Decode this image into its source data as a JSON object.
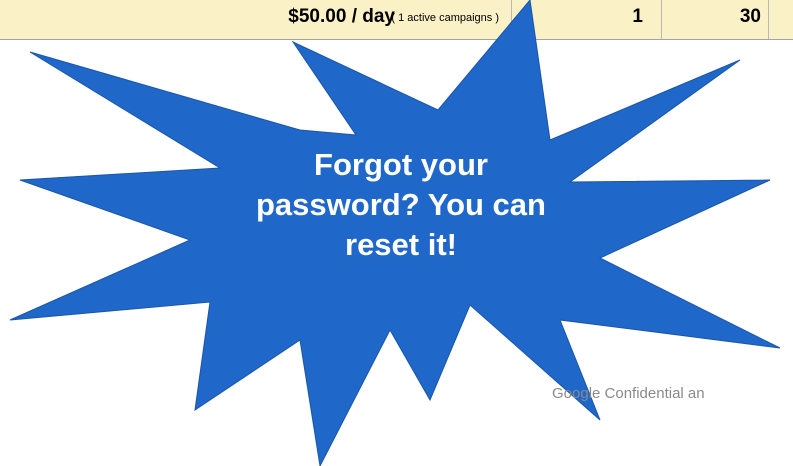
{
  "summary_row": {
    "budget_amount": "$50.00 / day",
    "budget_note": "( 1 active campaigns )",
    "count_1": "1",
    "count_2": "30"
  },
  "callout": {
    "text": "Forgot your password? You can reset it!",
    "fill_color": "#1f67c9",
    "text_color": "#ffffff"
  },
  "footer": {
    "text": "Google Confidential an"
  },
  "colors": {
    "row_background": "#fbf1c7",
    "footer_text": "#8a8a8a"
  }
}
